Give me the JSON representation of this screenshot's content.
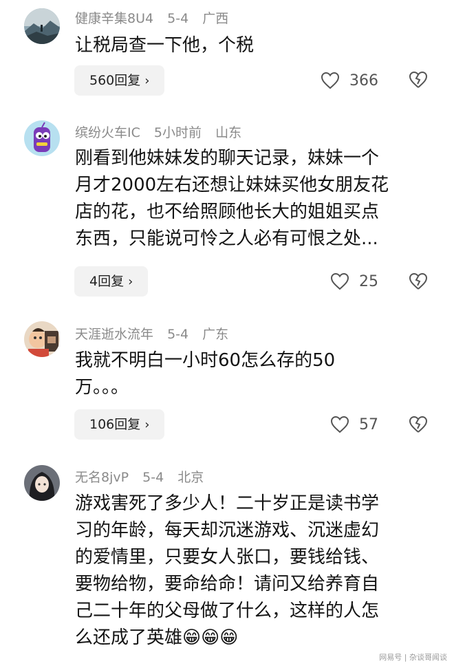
{
  "comments": [
    {
      "username": "健康辛集8U4",
      "date": "5-4",
      "location": "广西",
      "lines": [
        "让税局查一下他，个税"
      ],
      "replies": "560回复",
      "likes": "366",
      "avatar_icon": "landscape-avatar-icon"
    },
    {
      "username": "缤纷火车IC",
      "date": "5小时前",
      "location": "山东",
      "lines": [
        "刚看到他妹妹发的聊天记录，妹妹一个",
        "月才2000左右还想让妹妹买他女朋友花",
        "店的花，也不给照顾他长大的姐姐买点",
        "东西，只能说可怜之人必有可恨之处..."
      ],
      "replies": "4回复",
      "likes": "25",
      "avatar_icon": "purple-cartoon-avatar-icon"
    },
    {
      "username": "天涯逝水流年",
      "date": "5-4",
      "location": "广东",
      "lines": [
        "我就不明白一小时60怎么存的50",
        "万。。。"
      ],
      "replies": "106回复",
      "likes": "57",
      "avatar_icon": "child-photo-avatar-icon"
    },
    {
      "username": "无名8jvP",
      "date": "5-4",
      "location": "北京",
      "lines": [
        "游戏害死了多少人！二十岁正是读书学",
        "习的年龄，每天却沉迷游戏、沉迷虚幻",
        "的爱情里，只要女人张口，要钱给钱、",
        "要物给物，要命给命！请问又给养育自",
        "己二十年的父母做了什么，这样的人怎",
        "么还成了英雄"
      ],
      "emojis": "😁😁😁",
      "avatar_icon": "anime-girl-avatar-icon"
    }
  ],
  "watermark": "网易号 | 杂谈哥闻谈",
  "colors": {
    "meta": "#8a8a8a",
    "reply_bg": "#f2f2f2",
    "text": "#141414"
  }
}
